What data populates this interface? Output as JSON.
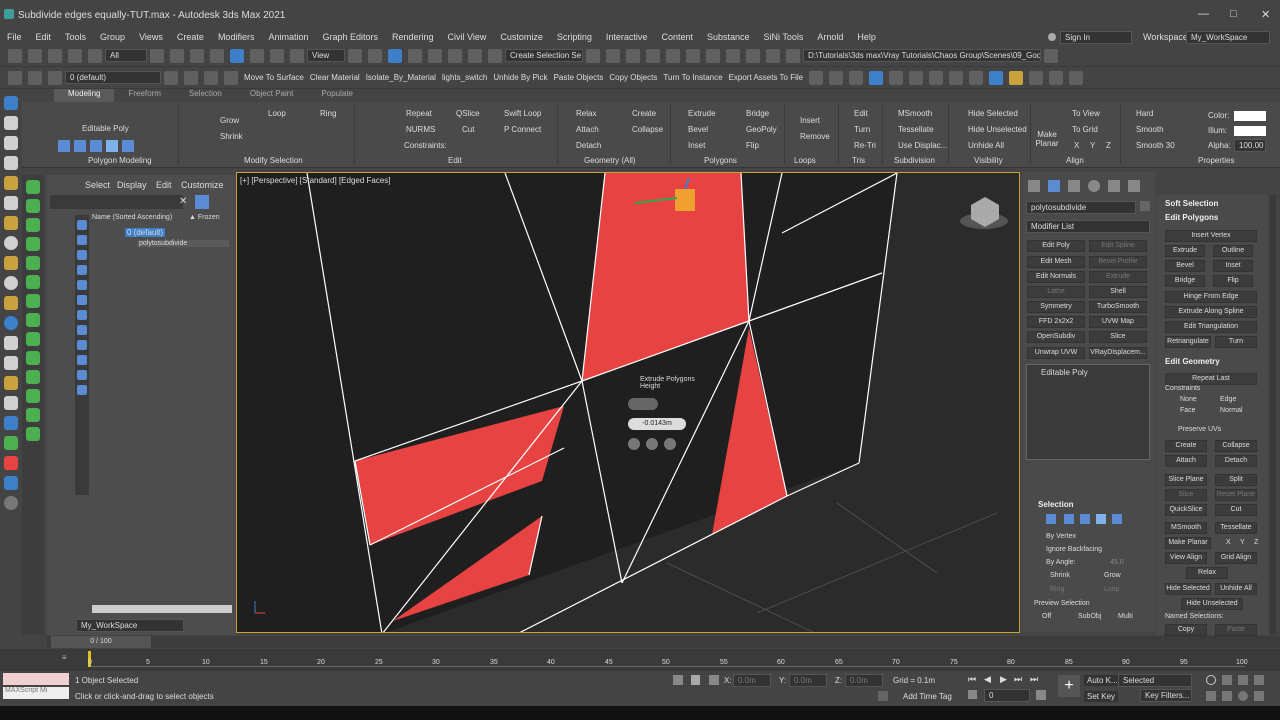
{
  "window": {
    "title": "Subdivide edges equally-TUT.max - Autodesk 3ds Max 2021"
  },
  "menu": [
    "File",
    "Edit",
    "Tools",
    "Group",
    "Views",
    "Create",
    "Modifiers",
    "Animation",
    "Graph Editors",
    "Rendering",
    "Civil View",
    "Customize",
    "Scripting",
    "Interactive",
    "Content",
    "Substance",
    "SiNi Tools",
    "Arnold",
    "Help"
  ],
  "signin": "Sign In",
  "workspaces_label": "Workspaces:",
  "workspace": "My_WorkSpace",
  "toolbar1": {
    "filter": "All",
    "view": "View",
    "selection_set": "Create Selection Se",
    "path": "D:\\Tutorials\\3ds max\\Vray Tutorials\\Chaos Group\\Scenes\\09_Godrays"
  },
  "toolbar2": {
    "layer": "0 (default)",
    "buttons": [
      "Move To Surface",
      "Clear Material",
      "Isolate_By_Material",
      "lights_switch",
      "Unhide By Pick",
      "Paste Objects",
      "Copy Objects",
      "Turn To Instance",
      "Export Assets To File"
    ]
  },
  "ribbon_tabs": [
    "Modeling",
    "Freeform",
    "Selection",
    "Object Paint",
    "Populate"
  ],
  "ribbon": {
    "editable_poly": "Editable Poly",
    "grow": "Grow",
    "shrink": "Shrink",
    "loop": "Loop",
    "ring": "Ring",
    "repeat": "Repeat",
    "qslice": "QSlice",
    "swift_loop": "Swift Loop",
    "nurms": "NURMS",
    "cut": "Cut",
    "pconnect": "P Connect",
    "constraints": "Constraints:",
    "relax": "Relax",
    "create": "Create",
    "attach": "Attach",
    "collapse": "Collapse",
    "detach": "Detach",
    "extrude": "Extrude",
    "bridge": "Bridge",
    "bevel": "Bevel",
    "geopoly": "GeoPoly",
    "inset": "Inset",
    "flip": "Flip",
    "insert": "Insert",
    "remove": "Remove",
    "edit": "Edit",
    "turn": "Turn",
    "retri": "Re-Tri",
    "msmooth": "MSmooth",
    "tessellate": "Tessellate",
    "use_displac": "Use Displac...",
    "hide_selected": "Hide Selected",
    "hide_unselected": "Hide Unselected",
    "unhide_all": "Unhide All",
    "make_planar": "Make Planar",
    "to_view": "To View",
    "to_grid": "To Grid",
    "x": "X",
    "y": "Y",
    "z": "Z",
    "hard": "Hard",
    "smooth": "Smooth",
    "smooth30": "Smooth 30",
    "color": "Color:",
    "illum": "Illum:",
    "alpha": "Alpha:",
    "alpha_val": "100.00",
    "groups": [
      "Polygon Modeling",
      "Modify Selection",
      "Edit",
      "Geometry (All)",
      "Polygons",
      "Loops",
      "Tris",
      "Subdivision",
      "Visibility",
      "Align",
      "Properties"
    ]
  },
  "scene_explorer": {
    "tabs": [
      "Select",
      "Display",
      "Edit",
      "Customize"
    ],
    "col_name": "Name (Sorted Ascending)",
    "col_frozen": "▲ Frozen",
    "layer": "0 (default)",
    "object": "polytosubdivide",
    "workspace": "My_WorkSpace"
  },
  "viewport": {
    "label": "[+] [Perspective] [Standard] [Edged Faces]",
    "caddy_title": "Extrude Polygons",
    "caddy_sub": "Height",
    "caddy_value": "-0.0143m",
    "accent": "#e84343"
  },
  "command_panel": {
    "object_name": "polytosubdivide",
    "modifier_list": "Modifier List",
    "modifiers": [
      "Edit Poly",
      "Edit Spline",
      "Edit Mesh",
      "Bevel Profile",
      "Edit Normals",
      "Extrude",
      "Lathe",
      "Shell",
      "Symmetry",
      "TurboSmooth",
      "FFD 2x2x2",
      "UVW Map",
      "OpenSubdiv",
      "Slice",
      "Unwrap UVW",
      "VRayDisplacem..."
    ],
    "stack_item": "Editable Poly",
    "selection": "Selection",
    "by_vertex": "By Vertex",
    "ignore_backfacing": "Ignore Backfacing",
    "by_angle": "By Angle:",
    "angle_val": "45.0",
    "shrink": "Shrink",
    "grow": "Grow",
    "ring": "Ring",
    "loop": "Loop",
    "preview_selection": "Preview Selection",
    "off": "Off",
    "subobj": "SubObj",
    "multi": "Multi"
  },
  "right_panel": {
    "soft_selection": "Soft Selection",
    "edit_polygons": "Edit Polygons",
    "insert_vertex": "Insert Vertex",
    "extrude": "Extrude",
    "outline": "Outline",
    "bevel": "Bevel",
    "inset": "Inset",
    "bridge": "Bridge",
    "flip": "Flip",
    "hinge": "Hinge From Edge",
    "extrude_spline": "Extrude Along Spline",
    "edit_tri": "Edit Triangulation",
    "retriangulate": "Retriangulate",
    "turn": "Turn",
    "edit_geometry": "Edit Geometry",
    "repeat_last": "Repeat Last",
    "constraints": "Constraints",
    "none": "None",
    "edge": "Edge",
    "face": "Face",
    "normal": "Normal",
    "preserve_uvs": "Preserve UVs",
    "create": "Create",
    "collapse": "Collapse",
    "attach": "Attach",
    "detach": "Detach",
    "slice_plane": "Slice Plane",
    "split": "Split",
    "slice": "Slice",
    "reset_plane": "Reset Plane",
    "quickslice": "QuickSlice",
    "cut": "Cut",
    "msmooth": "MSmooth",
    "tessellate": "Tessellate",
    "make_planar": "Make Planar",
    "x": "X",
    "y": "Y",
    "z": "Z",
    "view_align": "View Align",
    "grid_align": "Grid Align",
    "relax": "Relax",
    "hide_selected": "Hide Selected",
    "unhide_all": "Unhide All",
    "hide_unselected": "Hide Unselected",
    "named_selections": "Named Selections:",
    "copy": "Copy",
    "paste": "Paste"
  },
  "timeline": {
    "frame": "0 / 100",
    "ticks": [
      "0",
      "5",
      "10",
      "15",
      "20",
      "25",
      "30",
      "35",
      "40",
      "45",
      "50",
      "55",
      "60",
      "65",
      "70",
      "75",
      "80",
      "85",
      "90",
      "95",
      "100"
    ]
  },
  "status": {
    "maxscript": "MAXScript Mi",
    "selected": "1 Object Selected",
    "prompt": "Click or click-and-drag to select objects",
    "x_label": "X:",
    "x_val": "0.0m",
    "y_label": "Y:",
    "y_val": "0.0m",
    "z_label": "Z:",
    "z_val": "0.0m",
    "grid": "Grid = 0.1m",
    "add_time_tag": "Add Time Tag",
    "frame_val": "0",
    "auto_key": "Auto K...",
    "set_key": "Set Key",
    "selected_dd": "Selected",
    "key_filters": "Key Filters..."
  }
}
